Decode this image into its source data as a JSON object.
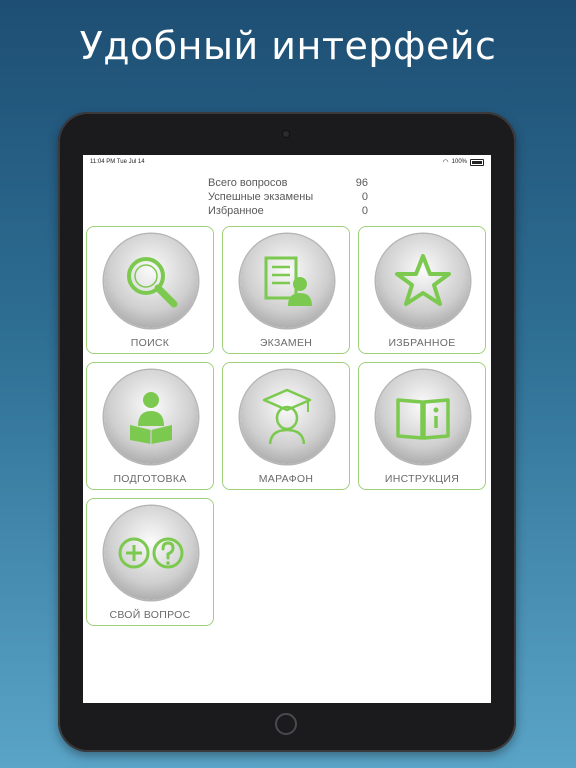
{
  "headline": "Удобный интерфейс",
  "status_bar": {
    "time": "11:04 PM  Tue Jul 14",
    "battery": "100%"
  },
  "stats": [
    {
      "label": "Всего вопросов",
      "value": "96"
    },
    {
      "label": "Успешные экзамены",
      "value": "0"
    },
    {
      "label": "Избранное",
      "value": "0"
    }
  ],
  "tiles": [
    {
      "label": "ПОИСК",
      "icon": "search-icon"
    },
    {
      "label": "ЭКЗАМЕН",
      "icon": "exam-icon"
    },
    {
      "label": "ИЗБРАННОЕ",
      "icon": "star-icon"
    },
    {
      "label": "ПОДГОТОВКА",
      "icon": "reading-icon"
    },
    {
      "label": "МАРАФОН",
      "icon": "graduate-icon"
    },
    {
      "label": "ИНСТРУКЦИЯ",
      "icon": "book-info-icon"
    },
    {
      "label": "СВОЙ ВОПРОС",
      "icon": "plus-question-icon"
    }
  ],
  "colors": {
    "accent": "#7cc94f",
    "tile_border": "#9fd07a"
  }
}
